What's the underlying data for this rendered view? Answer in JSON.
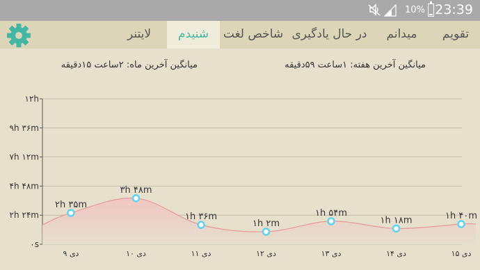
{
  "status_bar": {
    "time": "23:39",
    "battery_percent": "10%",
    "icons": [
      "mute-icon",
      "signal-icon",
      "battery-icon"
    ]
  },
  "tabs": [
    {
      "label": "تقویم",
      "active": false
    },
    {
      "label": "میدانم",
      "active": false
    },
    {
      "label": "در حال یادگیری",
      "active": false
    },
    {
      "label": "شاخص لغت",
      "active": false
    },
    {
      "label": "شنیدم",
      "active": true
    },
    {
      "label": "لایتنر",
      "active": false
    }
  ],
  "settings_icon": "gear-icon",
  "colors": {
    "accent": "#43b7a4",
    "line": "#e79a9a",
    "area_top": "#f1c6c3",
    "point": "#5fd3f0",
    "tabbar": "#dcd5b8",
    "background": "#e6e0cc"
  },
  "averages": {
    "week": "میانگین آخرین هفته: ۱ساعت  ۵۹دقیقه",
    "month": "میانگین آخرین ماه: ۲ساعت  ۱۵دقیقه"
  },
  "chart_data": {
    "type": "area",
    "categories": [
      "۹ دی",
      "۱۰ دی",
      "۱۱ دی",
      "۱۲ دی",
      "۱۳ دی",
      "۱۴ دی",
      "۱۵ دی"
    ],
    "values_minutes": [
      155,
      228,
      96,
      62,
      114,
      78,
      100
    ],
    "data_labels": [
      "۲h ۳۵m",
      "۳h ۴۸m",
      "۱h ۳۶m",
      "۱h ۲m",
      "۱h ۵۴m",
      "۱h ۱۸m",
      "۱h ۴۰m"
    ],
    "y_ticks": [
      "۰s",
      "۲h ۲۴m",
      "۴h ۴۸m",
      "۷h ۱۲m",
      "۹h ۳۶m",
      "۱۲h"
    ],
    "y_tick_values_minutes": [
      0,
      144,
      288,
      432,
      576,
      720
    ],
    "ylim": [
      0,
      720
    ],
    "grid": true,
    "legend": "none"
  }
}
